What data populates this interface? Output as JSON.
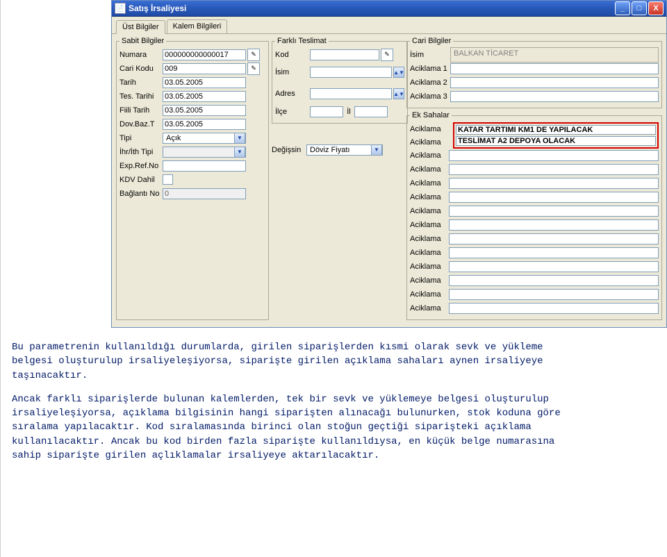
{
  "window": {
    "title": "Satış İrsaliyesi"
  },
  "tabs": {
    "ust": "Üst Bilgiler",
    "kalem": "Kalem Bilgileri"
  },
  "sabit": {
    "legend": "Sabit Bilgiler",
    "numara_label": "Numara",
    "numara_value": "000000000000017",
    "cari_kodu_label": "Cari Kodu",
    "cari_kodu_value": "009",
    "tarih_label": "Tarih",
    "tarih_value": "03.05.2005",
    "tes_tarihi_label": "Tes. Tarihi",
    "tes_tarihi_value": "03.05.2005",
    "fiili_tarih_label": "Fiili Tarih",
    "fiili_tarih_value": "03.05.2005",
    "dov_baz_label": "Dov.Baz.T",
    "dov_baz_value": "03.05.2005",
    "tipi_label": "Tipi",
    "tipi_value": "Açık",
    "ihr_ith_label": "İhr/İth Tipi",
    "ihr_ith_value": "",
    "exp_ref_label": "Exp.Ref.No",
    "exp_ref_value": "",
    "kdv_dahil_label": "KDV Dahil",
    "baglanti_label": "Bağlantı No",
    "baglanti_value": "0"
  },
  "farkli": {
    "legend": "Farklı Teslimat",
    "kod_label": "Kod",
    "kod_value": "",
    "isim_label": "İsim",
    "isim_value": "",
    "adres_label": "Adres",
    "adres_value": "",
    "ilce_label": "İlçe",
    "il_label": "İl",
    "degissin_label": "Değişsin",
    "degissin_value": "Döviz Fiyatı"
  },
  "cari": {
    "legend": "Cari Bilgiler",
    "isim_label": "İsim",
    "isim_value": "BALKAN TİCARET",
    "aciklama1_label": "Aciklama 1",
    "aciklama1_value": "",
    "aciklama2_label": "Aciklama 2",
    "aciklama2_value": "",
    "aciklama3_label": "Aciklama 3",
    "aciklama3_value": ""
  },
  "ek": {
    "legend": "Ek Sahalar",
    "aciklama_label": "Aciklama",
    "highlight1": "KATAR TARTIMI KM1 DE YAPILACAK",
    "highlight2": "TESLİMAT A2 DEPOYA OLACAK",
    "blank": ""
  },
  "bodytext": {
    "p1": "Bu parametrenin kullanıldığı durumlarda, girilen siparişlerden kısmi olarak sevk ve yükleme belgesi oluşturulup irsaliyeleşiyorsa, siparişte girilen açıklama sahaları aynen irsaliyeye taşınacaktır.",
    "p2": "Ancak farklı siparişlerde bulunan kalemlerden, tek bir sevk ve yüklemeye belgesi oluşturulup irsaliyeleşiyorsa, açıklama bilgisinin hangi siparişten alınacağı bulunurken, stok koduna göre sıralama yapılacaktır. Kod sıralamasında birinci olan stoğun geçtiği siparişteki açıklama kullanılacaktır. Ancak bu kod birden fazla siparişte kullanıldıysa, en küçük belge numarasına sahip siparişte girilen açlıklamalar irsaliyeye aktarılacaktır."
  }
}
